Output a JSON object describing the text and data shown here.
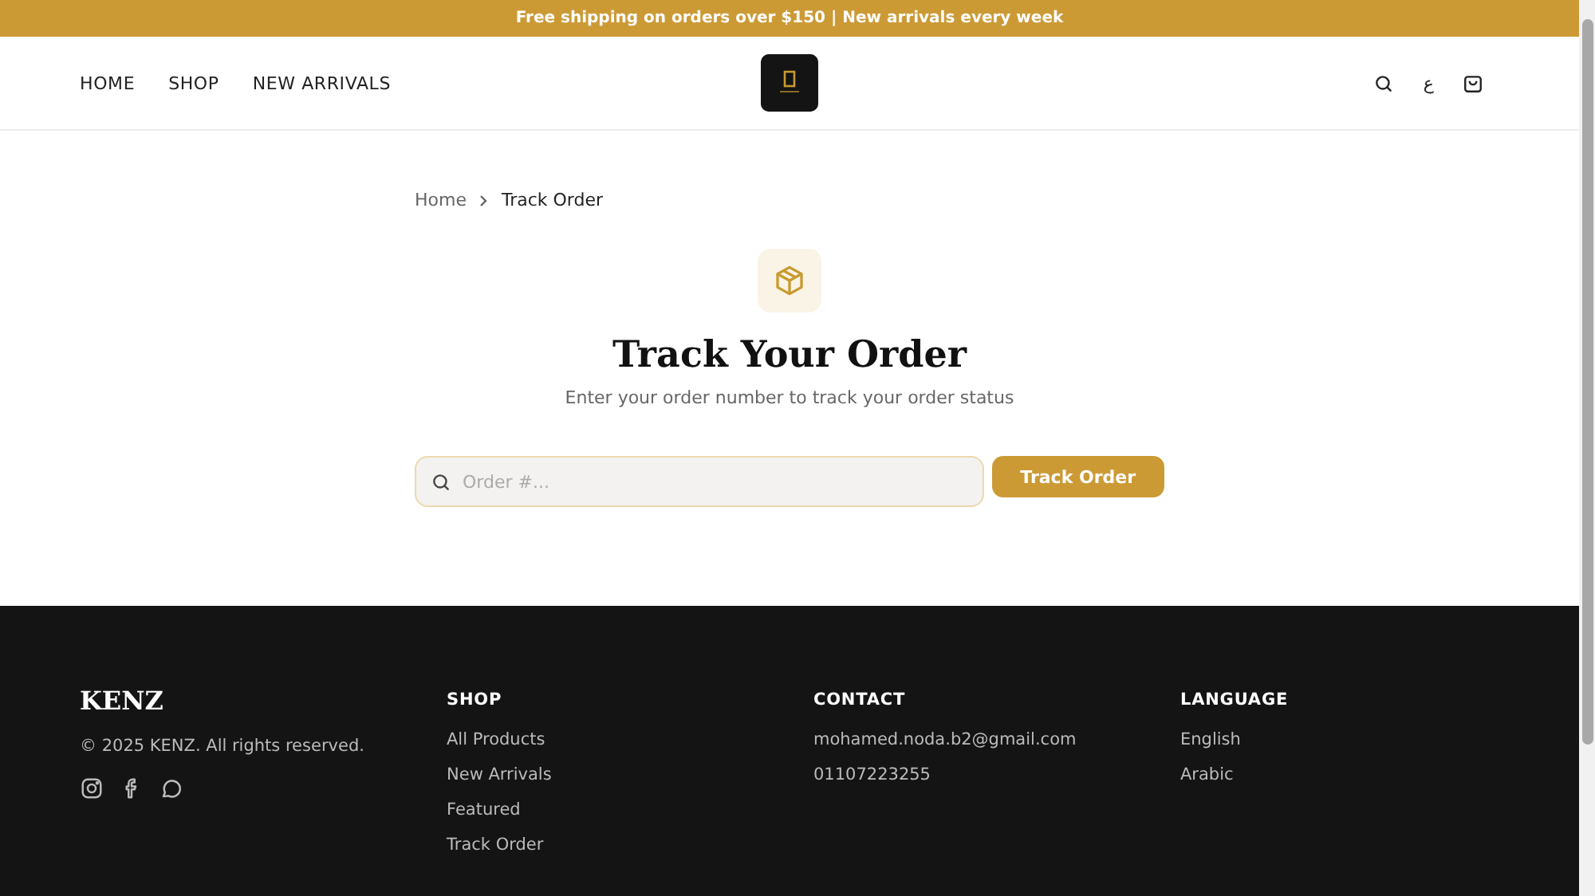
{
  "announcement": "Free shipping on orders over $150 | New arrivals every week",
  "nav": [
    {
      "label": "HOME"
    },
    {
      "label": "SHOP"
    },
    {
      "label": "NEW ARRIVALS"
    }
  ],
  "header_actions": {
    "language_toggle": "ع"
  },
  "breadcrumb": [
    {
      "label": "Home",
      "current": false
    },
    {
      "label": "Track Order",
      "current": true
    }
  ],
  "title": "Track Your Order",
  "subtitle": "Enter your order number to track your order status",
  "search": {
    "placeholder": "Order #..."
  },
  "submit_button": "Track Order",
  "footer": {
    "brand": "KENZ",
    "copyright": "© 2025 KENZ. All rights reserved.",
    "columns": [
      {
        "heading": "SHOP",
        "links": [
          "All Products",
          "New Arrivals",
          "Featured",
          "Track Order"
        ]
      },
      {
        "heading": "CONTACT",
        "links": [
          "mohamed.noda.b2@gmail.com",
          "01107223255"
        ]
      },
      {
        "heading": "LANGUAGE",
        "links": [
          "English",
          "Arabic"
        ]
      }
    ]
  }
}
